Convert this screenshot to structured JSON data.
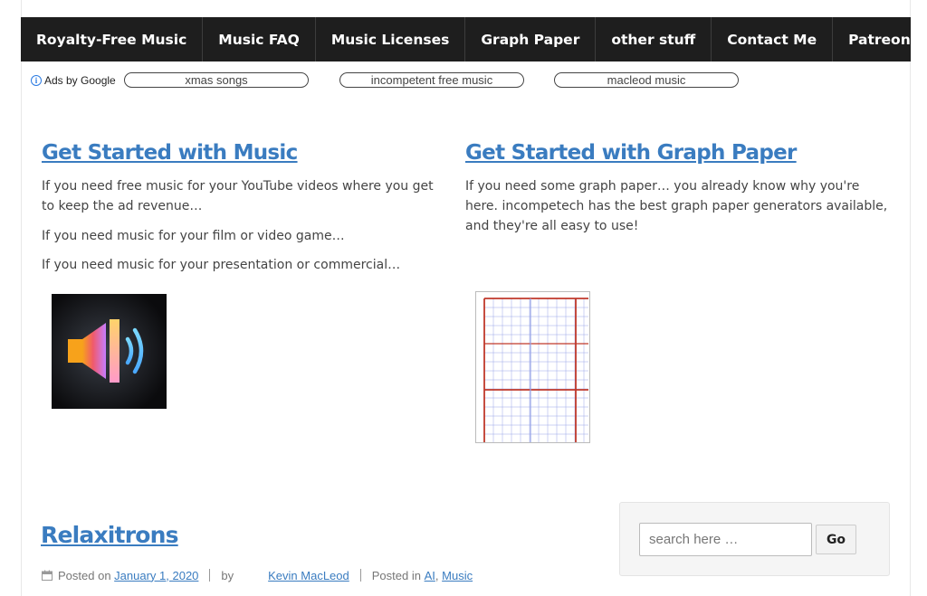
{
  "nav": {
    "items": [
      {
        "label": "Royalty-Free Music"
      },
      {
        "label": "Music FAQ"
      },
      {
        "label": "Music Licenses"
      },
      {
        "label": "Graph Paper"
      },
      {
        "label": "other stuff"
      },
      {
        "label": "Contact Me"
      },
      {
        "label": "Patreon"
      }
    ]
  },
  "ads": {
    "label": "Ads by Google",
    "links": [
      "xmas songs",
      "incompetent free music",
      "macleod music"
    ]
  },
  "music": {
    "title": "Get Started with Music",
    "para1": "If you need free music for your YouTube videos where you get to keep the ad revenue…",
    "para2": "If you need music for your film or video game…",
    "para3": "If you need music for your presentation or commercial…"
  },
  "graph": {
    "title": "Get Started with Graph Paper",
    "para1": "If you need some graph paper… you already know why you're here. incompetech has the best graph paper generators available, and they're all easy to use!"
  },
  "post": {
    "title": "Relaxitrons",
    "posted_on": "Posted on",
    "date": "January 1, 2020",
    "by": "by",
    "author": "Kevin MacLeod",
    "posted_in": "Posted in",
    "cat1": "AI",
    "comma": ",",
    "cat2": "Music"
  },
  "search": {
    "placeholder": "search here …",
    "go_label": "Go"
  },
  "colors": {
    "nav_bg": "#1e1e1e",
    "link": "#3a7cc0",
    "graph_line_major": "#c0392b",
    "graph_line_minor": "#9aa6e8"
  }
}
